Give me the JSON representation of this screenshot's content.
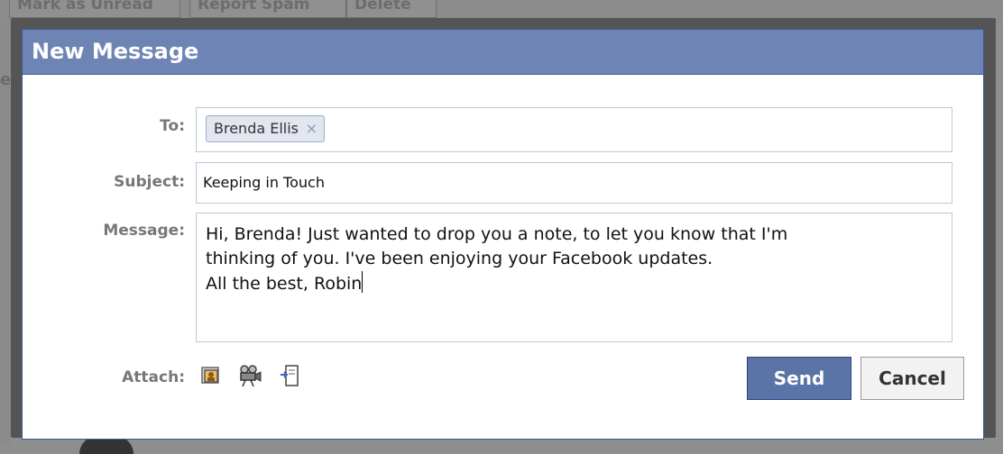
{
  "background": {
    "toolbar_buttons": [
      "Mark as Unread",
      "Report Spam",
      "Delete"
    ],
    "left_fragment": "e"
  },
  "dialog": {
    "title": "New Message",
    "to": {
      "label": "To:",
      "recipients": [
        {
          "name": "Brenda Ellis",
          "remove": "×"
        }
      ]
    },
    "subject": {
      "label": "Subject:",
      "value": "Keeping in Touch"
    },
    "message": {
      "label": "Message:",
      "value": "Hi, Brenda!  Just wanted to drop you a note, to let you know that I'm\nthinking of you.  I've been enjoying your Facebook updates.\nAll the best, Robin"
    },
    "attach": {
      "label": "Attach:",
      "icons": [
        "photo-icon",
        "video-icon",
        "share-link-icon"
      ]
    },
    "buttons": {
      "send": "Send",
      "cancel": "Cancel"
    }
  },
  "colors": {
    "title_bar": "#6d84b4",
    "border": "#3b5998",
    "send_button": "#5b74a8",
    "field_border": "#bdc7d8",
    "label": "#777777"
  }
}
